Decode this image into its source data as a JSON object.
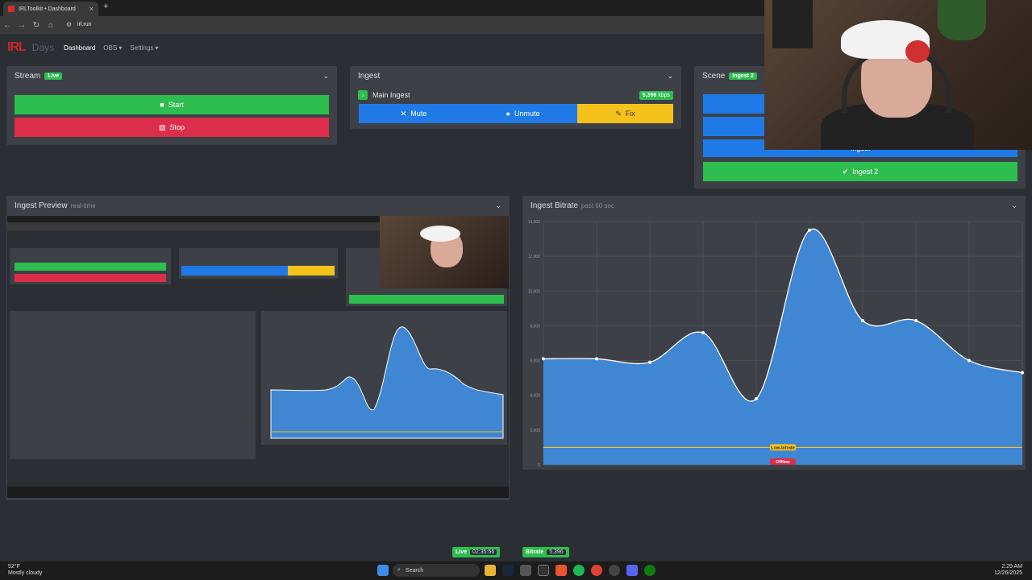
{
  "browser": {
    "tab_title": "IRLToolkit • Dashboard",
    "new_tab": "+",
    "close": "×",
    "url": "irl.run"
  },
  "appnav": {
    "logo": "IRL",
    "logo_sub": "Days",
    "items": [
      "Dashboard",
      "OBS ▾",
      "Settings ▾"
    ]
  },
  "stream_panel": {
    "title": "Stream",
    "badge": "Live",
    "start_label": "Start",
    "stop_label": "Stop"
  },
  "ingest_panel": {
    "title": "Ingest",
    "ingest_name": "Main Ingest",
    "kbps_value": "5,396",
    "kbps_unit": "kbps",
    "mute_label": "Mute",
    "unmute_label": "Unmute",
    "fix_label": "Fix"
  },
  "scene_panel": {
    "title": "Scene",
    "badge": "Ingest 2",
    "partial_label": "Ingest",
    "active_label": "Ingest 2"
  },
  "preview_panel": {
    "title": "Ingest Preview",
    "subtitle": "real-time"
  },
  "bitrate_panel": {
    "title": "Ingest Bitrate",
    "subtitle": "past 60 sec"
  },
  "chart_data": {
    "type": "area",
    "title": "Ingest Bitrate",
    "subtitle": "past 60 sec",
    "xlabel": "",
    "ylabel": "",
    "ylim": [
      0,
      14000
    ],
    "y_ticks": [
      "0",
      "2,000",
      "4,000",
      "6,000",
      "8,000",
      "10,000",
      "12,000",
      "14,000"
    ],
    "x": [
      0,
      1,
      2,
      3,
      4,
      5,
      6,
      7,
      8,
      9
    ],
    "values": [
      6100,
      6100,
      5900,
      7600,
      3800,
      13500,
      8300,
      8300,
      6000,
      5300
    ],
    "color": "#3f86d3",
    "annotations": [
      {
        "label": "Low-bitrate",
        "y": 1000,
        "color": "#f5c21b"
      },
      {
        "label": "Offline",
        "y": 0,
        "color": "#dc2e4a"
      }
    ],
    "grid": true
  },
  "footer": {
    "live_label": "Live",
    "live_time": "02:35:56",
    "bitrate_label": "Bitrate",
    "bitrate_value": "5,396"
  },
  "taskbar": {
    "temp": "52°F",
    "weather": "Mostly cloudy",
    "search": "Search",
    "time": "2:29 AM",
    "date": "12/26/2025"
  }
}
